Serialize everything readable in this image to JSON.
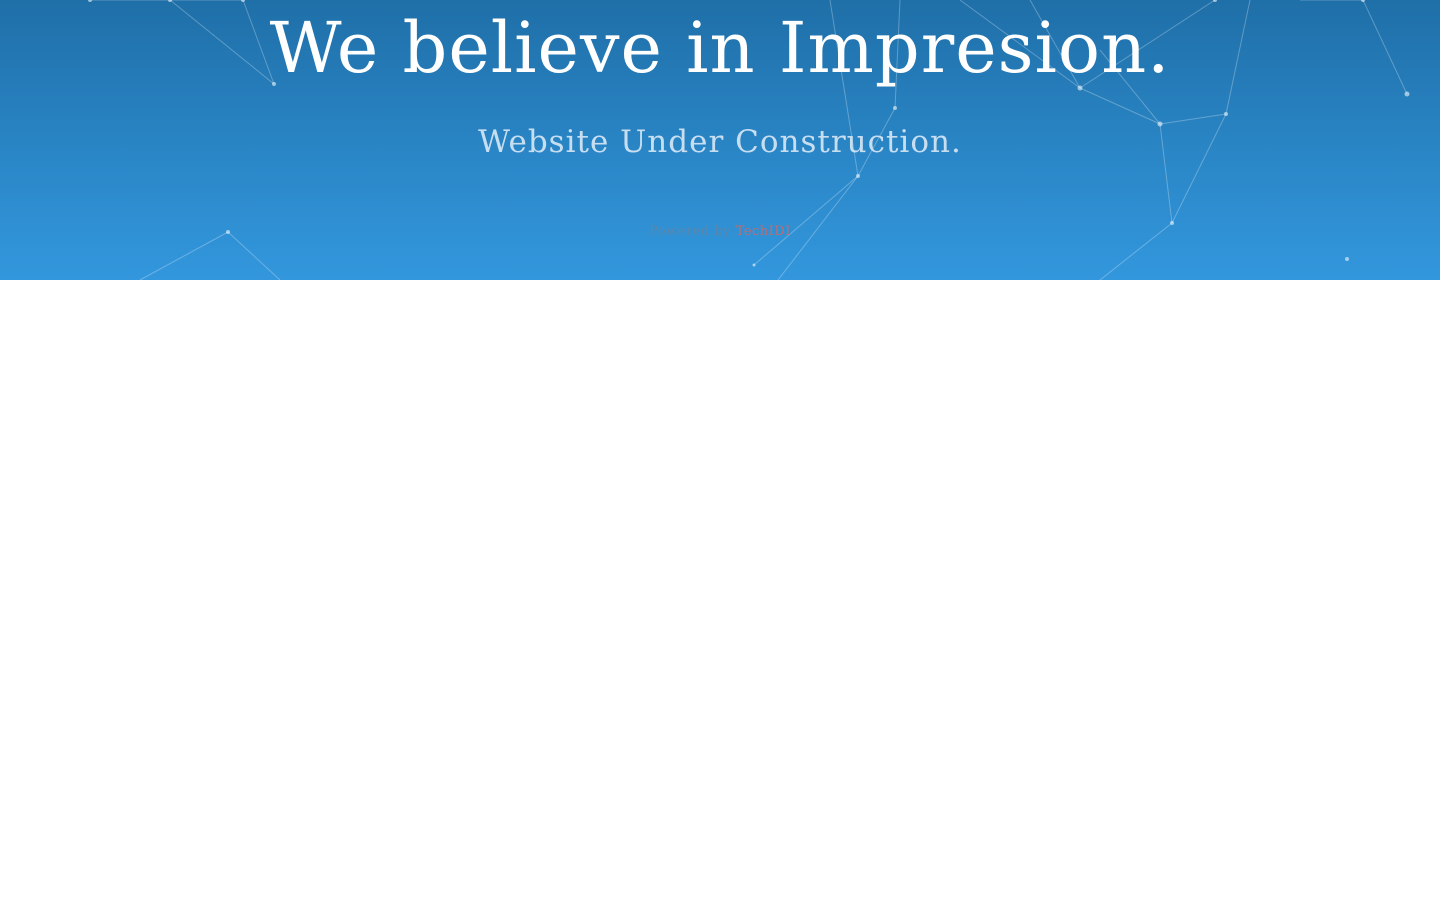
{
  "hero": {
    "headline": "We believe in Impresion.",
    "subheadline": "Website Under Construction.",
    "powered_by_prefix": "Powered by",
    "powered_by_link": "TechIDI"
  },
  "colors": {
    "gradient_top": "#1f6fa8",
    "gradient_bottom": "#3397dd",
    "headline": "#ffffff",
    "subheadline": "#c7def1",
    "powered_by_text": "#5b87ad",
    "powered_by_link": "#c56a6a"
  }
}
